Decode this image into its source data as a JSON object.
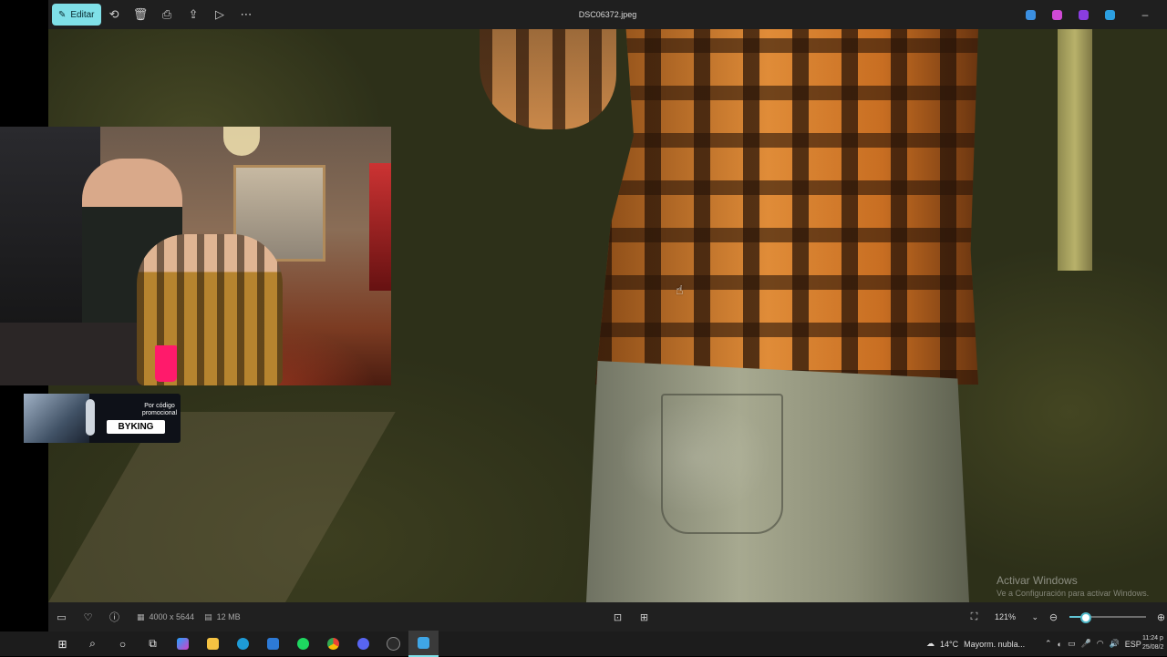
{
  "titlebar": {
    "edit_label": "Editar",
    "filename": "DSC06372.jpeg",
    "minimize_glyph": "–"
  },
  "toolbar_icons": [
    "rotate-icon",
    "delete-icon",
    "print-icon",
    "share-icon",
    "slideshow-icon",
    "more-icon"
  ],
  "webcam_promo": {
    "line1": "Por código",
    "line2": "promocional",
    "code": "BYKING"
  },
  "watermark": {
    "title": "Activar Windows",
    "subtitle": "Ve a Configuración para activar Windows."
  },
  "bottombar": {
    "dimensions": "4000 x 5644",
    "size": "12 MB",
    "zoom": "121%",
    "zoom_level_fraction": 0.21
  },
  "taskbar": {
    "weather_temp": "14°C",
    "weather_desc": "Mayorm. nubla...",
    "language": "ESP",
    "time": "11:24 p",
    "date": "25/08/2"
  },
  "colors": {
    "accent": "#7fe0e8",
    "promo_pink": "#ff1a6b"
  }
}
